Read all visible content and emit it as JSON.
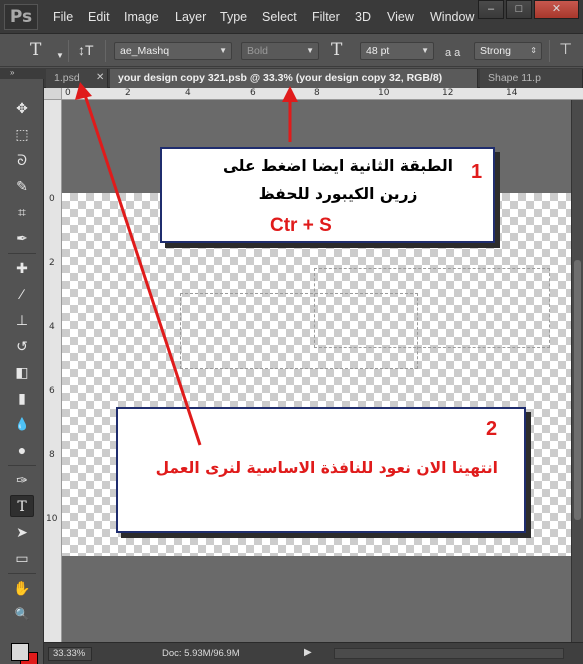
{
  "app": {
    "logo": "Ps",
    "menu": [
      "File",
      "Edit",
      "Image",
      "Layer",
      "Type",
      "Select",
      "Filter",
      "3D",
      "View",
      "Window"
    ],
    "window_controls": {
      "minimize": "–",
      "restore": "□",
      "close": "✕"
    }
  },
  "options_bar": {
    "tool_glyph": "T",
    "orient_glyph": "↕T",
    "font_family": "ae_Mashq",
    "font_style": "Bold",
    "size_glyph": "T",
    "font_size": "48 pt",
    "aa_glyph": "a a",
    "anti_alias": "Strong"
  },
  "tabs": [
    {
      "label": "1.psd",
      "active": false
    },
    {
      "label": "your design copy 321.psb @ 33.3% (your design copy 32, RGB/8)",
      "active": true
    },
    {
      "label": "Shape 11.p",
      "active": false
    }
  ],
  "panel_collapse_glyph": "»",
  "rulers": {
    "top": [
      "0",
      "2",
      "4",
      "6",
      "8",
      "10",
      "12",
      "14"
    ],
    "left": [
      "0",
      "2",
      "4",
      "6",
      "8",
      "10"
    ]
  },
  "tools": [
    {
      "name": "move-tool",
      "glyph": "✥"
    },
    {
      "name": "marquee-tool",
      "glyph": "⬚"
    },
    {
      "name": "lasso-tool",
      "glyph": "ᘐ"
    },
    {
      "name": "quick-select-tool",
      "glyph": "✎"
    },
    {
      "name": "crop-tool",
      "glyph": "⌗"
    },
    {
      "name": "eyedropper-tool",
      "glyph": "✒"
    },
    {
      "name": "healing-brush-tool",
      "glyph": "✚"
    },
    {
      "name": "brush-tool",
      "glyph": "∕"
    },
    {
      "name": "clone-stamp-tool",
      "glyph": "⊥"
    },
    {
      "name": "history-brush-tool",
      "glyph": "↺"
    },
    {
      "name": "eraser-tool",
      "glyph": "◧"
    },
    {
      "name": "gradient-tool",
      "glyph": "▮"
    },
    {
      "name": "blur-tool",
      "glyph": "💧"
    },
    {
      "name": "dodge-tool",
      "glyph": "●"
    },
    {
      "name": "pen-tool",
      "glyph": "✑"
    },
    {
      "name": "type-tool",
      "glyph": "T",
      "selected": true
    },
    {
      "name": "path-select-tool",
      "glyph": "➤"
    },
    {
      "name": "rectangle-tool",
      "glyph": "▭"
    },
    {
      "name": "hand-tool",
      "glyph": "✋"
    },
    {
      "name": "zoom-tool",
      "glyph": "🔍"
    }
  ],
  "colors": {
    "foreground": "#d9d9d9",
    "background": "#e01b1b",
    "accent_red": "#e01b1b",
    "callout_border": "#1f2d6e"
  },
  "status": {
    "zoom": "33.33%",
    "doc": "Doc: 5.93M/96.9M",
    "arrow": "▶"
  },
  "callout1": {
    "number": "1",
    "line1": "الطبقة الثانية ايضا اضغط على",
    "line2": "زرين الكيبورد للحفظ",
    "shortcut": "Ctr + S"
  },
  "callout2": {
    "number": "2",
    "line1": "انتهينا الان نعود للنافذة الاساسية لنرى العمل"
  }
}
